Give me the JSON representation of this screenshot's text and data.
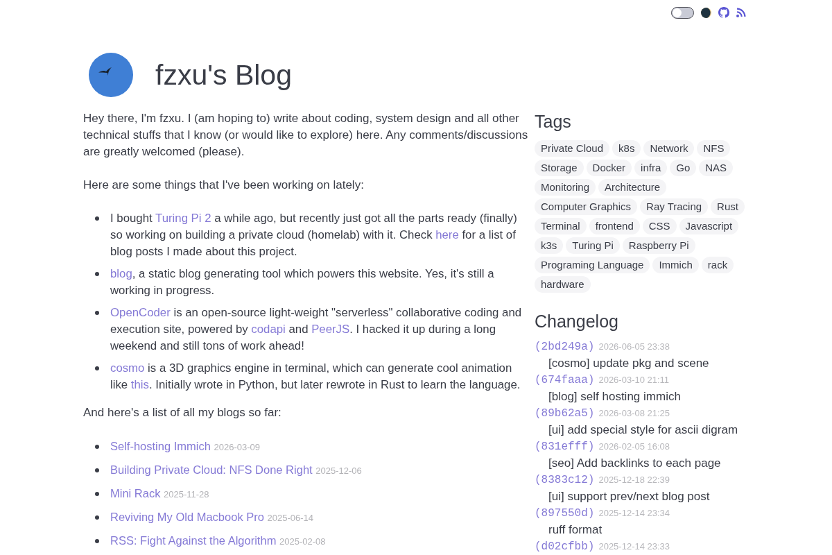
{
  "top_bar": {
    "theme_toggle": {
      "on": false
    }
  },
  "header": {
    "title": "fzxu's Blog"
  },
  "intro": "Hey there, I'm fzxu. I (am hoping to) write about coding, system design and all other technical stuffs that I know (or would like to explore) here. Any comments/discussions are greatly welcomed (please).",
  "projects_heading": "Here are some things that I've been working on lately:",
  "projects": [
    {
      "parts": [
        {
          "kind": "text",
          "text": "I bought "
        },
        {
          "kind": "link",
          "text": "Turing Pi 2"
        },
        {
          "kind": "text",
          "text": " a while ago, but recently just got all the parts ready (finally) so working on building a private cloud (homelab) with it. Check "
        },
        {
          "kind": "link",
          "text": "here"
        },
        {
          "kind": "text",
          "text": " for a list of blog posts I made about this project."
        }
      ]
    },
    {
      "parts": [
        {
          "kind": "link",
          "text": "blog"
        },
        {
          "kind": "text",
          "text": ", a static blog generating tool which powers this website. Yes, it's still a working in progress."
        }
      ]
    },
    {
      "parts": [
        {
          "kind": "link",
          "text": "OpenCoder"
        },
        {
          "kind": "text",
          "text": " is an open-source light-weight \"serverless\" collaborative coding and execution site, powered by "
        },
        {
          "kind": "link",
          "text": "codapi"
        },
        {
          "kind": "text",
          "text": " and "
        },
        {
          "kind": "link",
          "text": "PeerJS"
        },
        {
          "kind": "text",
          "text": ". I hacked it up during a long weekend and still tons of work ahead!"
        }
      ]
    },
    {
      "parts": [
        {
          "kind": "link",
          "text": "cosmo"
        },
        {
          "kind": "text",
          "text": " is a 3D graphics engine in terminal, which can generate cool animation like "
        },
        {
          "kind": "link",
          "text": "this"
        },
        {
          "kind": "text",
          "text": ". Initially wrote in Python, but later rewrote in Rust to learn the language."
        }
      ]
    }
  ],
  "posts_heading": "And here's a list of all my blogs so far:",
  "posts": [
    {
      "title": "Self-hosting Immich",
      "date": "2026-03-09"
    },
    {
      "title": "Building Private Cloud: NFS Done Right",
      "date": "2025-12-06"
    },
    {
      "title": "Mini Rack",
      "date": "2025-11-28"
    },
    {
      "title": "Reviving My Old Macbook Pro",
      "date": "2025-06-14"
    },
    {
      "title": "RSS: Fight Against the Algorithm",
      "date": "2025-02-08"
    }
  ],
  "tags": {
    "title": "Tags",
    "items": [
      "Private Cloud",
      "k8s",
      "Network",
      "NFS",
      "Storage",
      "Docker",
      "infra",
      "Go",
      "NAS",
      "Monitoring",
      "Architecture",
      "Computer Graphics",
      "Ray Tracing",
      "Rust",
      "Terminal",
      "frontend",
      "CSS",
      "Javascript",
      "k3s",
      "Turing Pi",
      "Raspberry Pi",
      "Programing Language",
      "Immich",
      "rack",
      "hardware"
    ]
  },
  "changelog": {
    "title": "Changelog",
    "entries": [
      {
        "hash": "(2bd249a)",
        "date": "2026-06-05 23:38",
        "message": "[cosmo] update pkg and scene"
      },
      {
        "hash": "(674faaa)",
        "date": "2026-03-10 21:11",
        "message": "[blog] self hosting immich"
      },
      {
        "hash": "(89b62a5)",
        "date": "2026-03-08 21:25",
        "message": "[ui] add special style for ascii digram"
      },
      {
        "hash": "(831efff)",
        "date": "2026-02-05 16:08",
        "message": "[seo] Add backlinks to each page"
      },
      {
        "hash": "(8383c12)",
        "date": "2025-12-18 22:39",
        "message": "[ui] support prev/next blog post"
      },
      {
        "hash": "(897550d)",
        "date": "2025-12-14 23:34",
        "message": "ruff format"
      },
      {
        "hash": "(d02cfbb)",
        "date": "2025-12-14 23:33"
      }
    ]
  }
}
